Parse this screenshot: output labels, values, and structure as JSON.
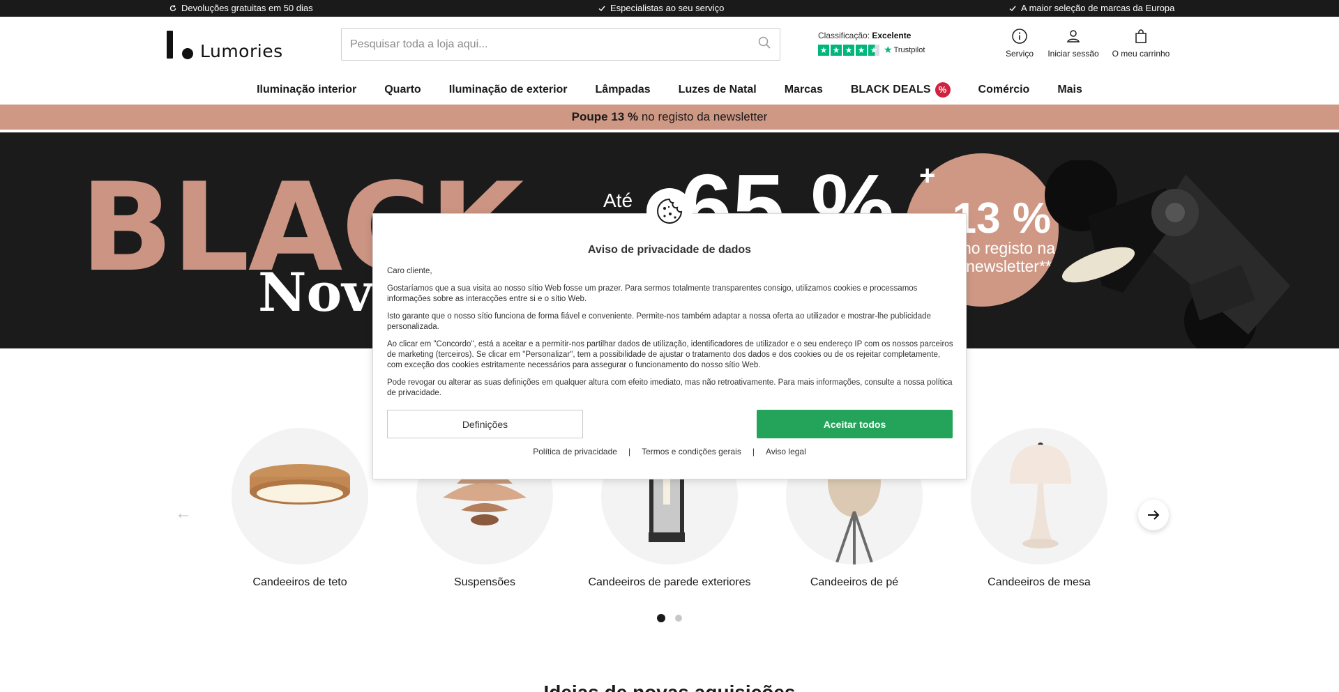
{
  "topbar": {
    "usp1": "Devoluções gratuitas em 50 dias",
    "usp2": "Especialistas ao seu serviço",
    "usp3": "A maior seleção de marcas da Europa"
  },
  "header": {
    "logo_text": "Lumories",
    "search_placeholder": "Pesquisar toda a loja aqui...",
    "trust_prefix": "Classificação:",
    "trust_rating": "Excelente",
    "trustpilot": "Trustpilot",
    "service": "Serviço",
    "login": "Iniciar sessão",
    "cart": "O meu carrinho"
  },
  "nav": {
    "items": [
      "Iluminação interior",
      "Quarto",
      "Iluminação de exterior",
      "Lâmpadas",
      "Luzes de Natal",
      "Marcas",
      "BLACK DEALS",
      "Comércio",
      "Mais"
    ],
    "badge": "%"
  },
  "newsletter": {
    "bold": "Poupe 13 %",
    "rest": " no registo da newsletter"
  },
  "hero": {
    "black": "BLACK",
    "nove": "Nove",
    "ate": "Até",
    "pct65": "65 %",
    "plus": "+",
    "pct13": "-13 %",
    "reg_line1": "no registo na",
    "reg_line2": "newsletter**"
  },
  "categories": [
    {
      "label": "Candeeiros de teto"
    },
    {
      "label": "Suspensões"
    },
    {
      "label": "Candeeiros de parede exteriores"
    },
    {
      "label": "Candeeiros de pé"
    },
    {
      "label": "Candeeiros de mesa"
    }
  ],
  "modal": {
    "title": "Aviso de privacidade de dados",
    "greeting": "Caro cliente,",
    "p1": "Gostaríamos que a sua visita ao nosso sítio Web fosse um prazer. Para sermos totalmente transparentes consigo, utilizamos cookies e processamos informações sobre as interacções entre si e o sítio Web.",
    "p2": "Isto garante que o nosso sítio funciona de forma fiável e conveniente. Permite-nos também adaptar a nossa oferta ao utilizador e mostrar-lhe publicidade personalizada.",
    "p3": "Ao clicar em \"Concordo\", está a aceitar e a permitir-nos partilhar dados de utilização, identificadores de utilizador e o seu endereço IP com os nossos parceiros de marketing (terceiros). Se clicar em \"Personalizar\", tem a possibilidade de ajustar o tratamento dos dados e dos cookies ou de os rejeitar completamente, com exceção dos cookies estritamente necessários para assegurar o funcionamento do nosso sítio Web.",
    "p4": "Pode revogar ou alterar as suas definições em qualquer altura com efeito imediato, mas não retroativamente. Para mais informações, consulte a nossa política de privacidade.",
    "btn_settings": "Definições",
    "btn_accept": "Aceitar todos",
    "link1": "Política de privacidade",
    "link2": "Termos e condições gerais",
    "link3": "Aviso legal",
    "sep": "|"
  },
  "bottom": {
    "heading": "Ideias de novas aquisições"
  },
  "colors": {
    "accent": "#cf9885",
    "accept": "#24a35a",
    "badge": "#d1213f",
    "trustpilot": "#00b67a"
  }
}
